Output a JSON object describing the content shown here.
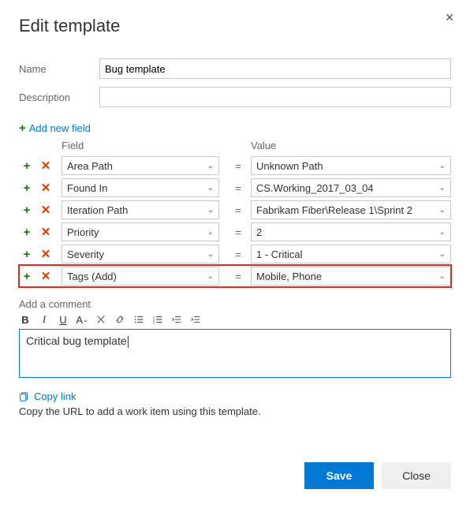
{
  "dialog": {
    "title": "Edit template",
    "close_icon": "✕"
  },
  "form": {
    "name_label": "Name",
    "name_value": "Bug template",
    "description_label": "Description",
    "description_value": ""
  },
  "add_field": {
    "label": "Add new field"
  },
  "grid": {
    "field_header": "Field",
    "value_header": "Value",
    "rows": [
      {
        "field": "Area Path",
        "value": "Unknown Path",
        "highlight": false
      },
      {
        "field": "Found In",
        "value": "CS.Working_2017_03_04",
        "highlight": false
      },
      {
        "field": "Iteration Path",
        "value": "Fabrikam Fiber\\Release 1\\Sprint 2",
        "highlight": false
      },
      {
        "field": "Priority",
        "value": "2",
        "highlight": false
      },
      {
        "field": "Severity",
        "value": "1 - Critical",
        "highlight": false
      },
      {
        "field": "Tags (Add)",
        "value": "Mobile, Phone",
        "highlight": true
      }
    ]
  },
  "comment": {
    "label": "Add a comment",
    "value": "Critical bug template"
  },
  "copy": {
    "link_label": "Copy link",
    "hint": "Copy the URL to add a work item using this template."
  },
  "footer": {
    "save": "Save",
    "close": "Close"
  }
}
